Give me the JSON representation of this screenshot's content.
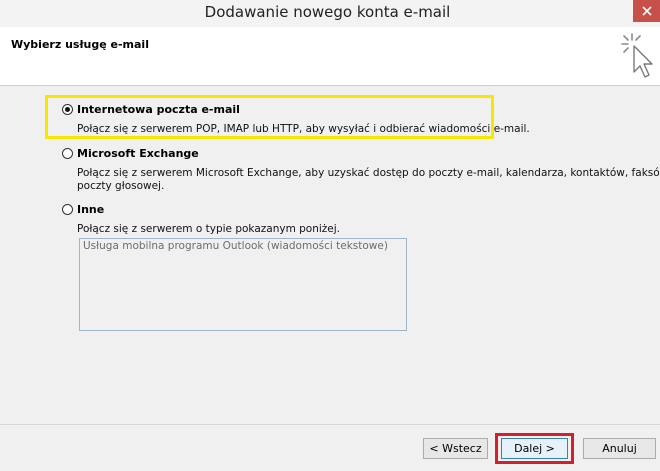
{
  "window": {
    "title": "Dodawanie nowego konta e-mail"
  },
  "header": {
    "title": "Wybierz usługę e-mail"
  },
  "options": [
    {
      "label": "Internetowa poczta e-mail",
      "description": "Połącz się z serwerem POP, IMAP lub HTTP, aby wysyłać i odbierać wiadomości e-mail.",
      "checked": true
    },
    {
      "label": "Microsoft Exchange",
      "description_line1": "Połącz się z serwerem Microsoft Exchange, aby uzyskać dostęp do poczty e-mail, kalendarza, kontaktów, faksów i",
      "description_line2": "poczty głosowej.",
      "checked": false
    },
    {
      "label": "Inne",
      "description": "Połącz się z serwerem o typie pokazanym poniżej.",
      "checked": false,
      "list_items": [
        "Usługa mobilna programu Outlook (wiadomości tekstowe)"
      ]
    }
  ],
  "buttons": {
    "back": "< Wstecz",
    "next": "Dalej >",
    "cancel": "Anuluj"
  },
  "colors": {
    "highlight_option": "#f6e600",
    "highlight_button": "#d2202f",
    "close_button": "#c7504a"
  }
}
